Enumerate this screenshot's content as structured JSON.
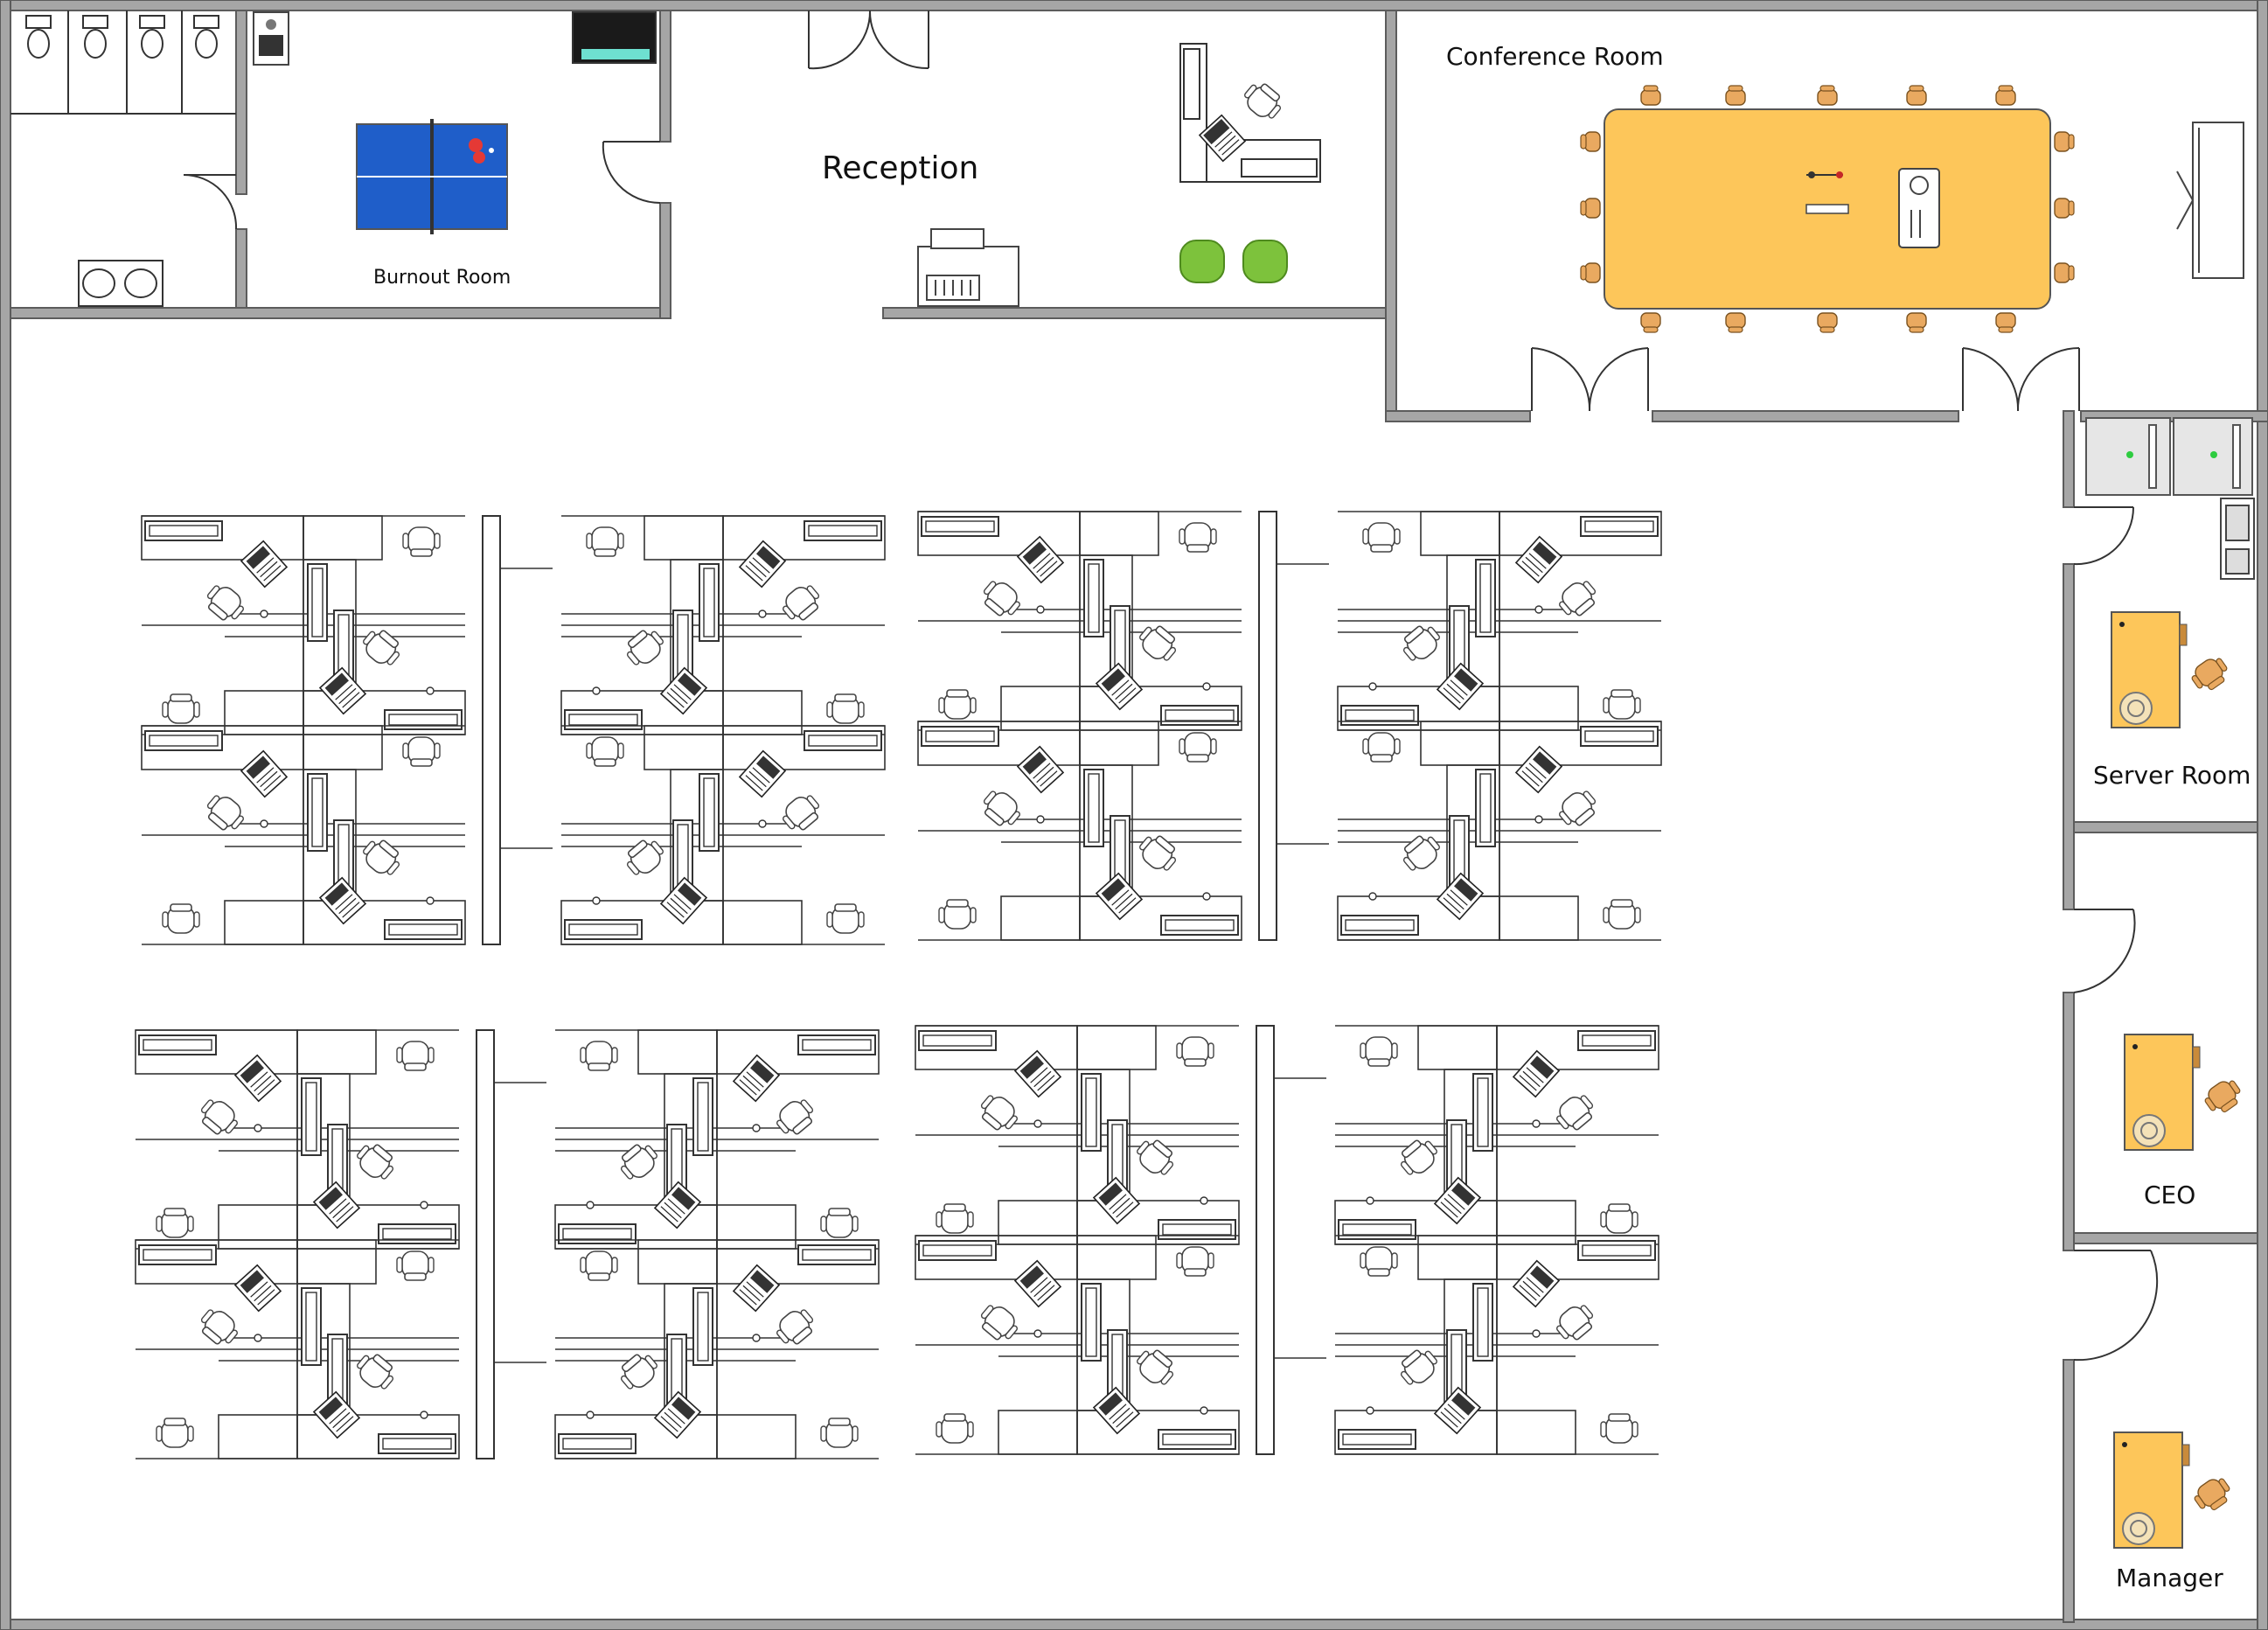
{
  "rooms": {
    "burnout": "Burnout Room",
    "reception": "Reception",
    "conference": "Conference Room",
    "server": "Server Room",
    "ceo": "CEO",
    "manager": "Manager"
  },
  "colors": {
    "wall_fill": "#a6a6a6",
    "wall_stroke": "#5c5c5c",
    "line": "#3a3a3a",
    "table_tennis": "#1f5ec9",
    "conference_table": "#fdc65a",
    "executive_desk": "#fdc65a",
    "chair_orange": "#e9a960",
    "armchair_green": "#7dc23c"
  },
  "icons": [
    "toilet-icon",
    "sink-icon",
    "coffee-machine-icon",
    "tv-cabinet-icon",
    "ping-pong-table-icon",
    "door-swing-icon",
    "reception-desk-icon",
    "printer-icon",
    "armchair-icon",
    "conference-table-icon",
    "projector-icon",
    "projection-screen-icon",
    "server-rack-icon",
    "patch-panel-icon",
    "office-chair-icon",
    "computer-icon",
    "cubicle-cluster-icon"
  ]
}
